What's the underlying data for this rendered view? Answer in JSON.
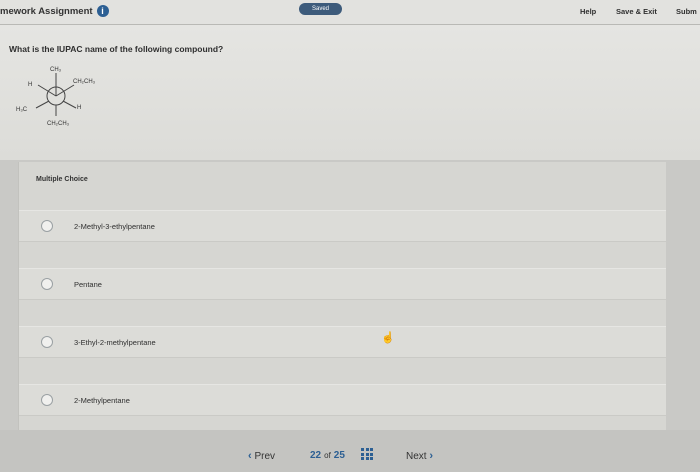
{
  "header": {
    "title": "mework Assignment",
    "status": "Saved",
    "help": "Help",
    "save_exit": "Save & Exit",
    "submit": "Subm"
  },
  "question": {
    "text": "What is the IUPAC name of the following compound?",
    "structure_labels": {
      "top": "CH₃",
      "left_front": "H",
      "right_front": "CH₂CH₃",
      "left_back": "H₃C",
      "right_back": "H",
      "bottom": "CH₂CH₃"
    }
  },
  "answers": {
    "heading": "Multiple Choice",
    "options": [
      "2-Methyl-3-ethylpentane",
      "Pentane",
      "3-Ethyl-2-methylpentane",
      "2-Methylpentane"
    ]
  },
  "nav": {
    "prev": "Prev",
    "current": "22",
    "of": "of",
    "total": "25",
    "next": "Next"
  }
}
